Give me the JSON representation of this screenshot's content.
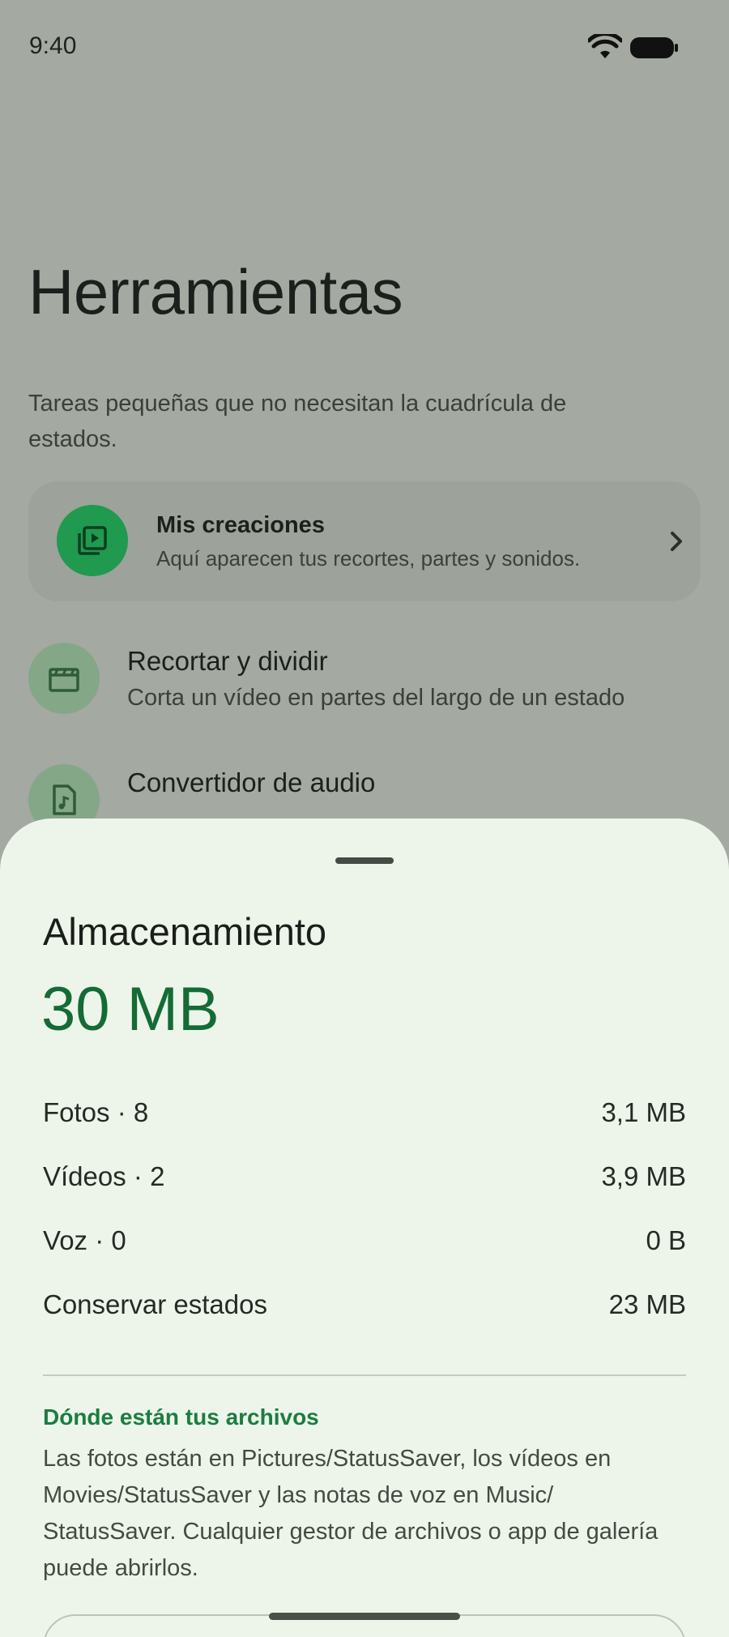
{
  "status_bar": {
    "time": "9:40"
  },
  "header": {
    "title": "Herramientas",
    "subtitle": "Tareas pequeñas que no necesitan la cuadrícula de estados."
  },
  "creations_card": {
    "title": "Mis creaciones",
    "description": "Aquí aparecen tus recortes, partes y sonidos.",
    "icon": "video-library-icon"
  },
  "tools": [
    {
      "title": "Recortar y dividir",
      "description": "Corta un vídeo en partes del largo de un estado",
      "icon": "clapperboard-icon"
    },
    {
      "title": "Convertidor de audio",
      "description": "",
      "icon": "audio-file-icon"
    }
  ],
  "storage_sheet": {
    "title": "Almacenamiento",
    "total": "30 MB",
    "rows": [
      {
        "label": "Fotos · 8",
        "value": "3,1 MB"
      },
      {
        "label": "Vídeos · 2",
        "value": "3,9 MB"
      },
      {
        "label": "Voz · 0",
        "value": "0 B"
      },
      {
        "label": "Conservar estados",
        "value": "23 MB"
      }
    ],
    "where_title": "Dónde están tus archivos",
    "where_body": "Las fotos están en Pictures/StatusSaver, los vídeos en Movies/StatusSaver y las notas de voz en Music/ StatusSaver. Cualquier gestor de archivos o app de galería puede abrirlos."
  },
  "colors": {
    "accent": "#146b35",
    "accent_bright": "#1f9a4e",
    "sheet_background": "#edf5ea",
    "scrim_background": "#a4a9a2"
  }
}
